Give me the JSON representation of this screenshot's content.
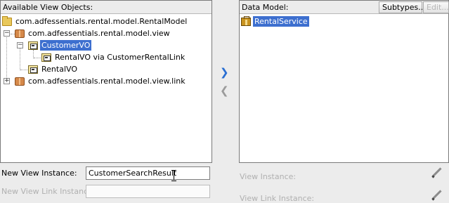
{
  "available": {
    "header": "Available View Objects:",
    "tree": [
      {
        "label": "com.adfessentials.rental.model.RentalModel",
        "icon": "folder-icon"
      },
      {
        "label": "com.adfessentials.rental.model.view",
        "icon": "package-icon",
        "expander": "−"
      },
      {
        "label": "CustomerVO",
        "icon": "view-object-icon",
        "expander": "−",
        "selected": true
      },
      {
        "label": "RentalVO via CustomerRentalLink",
        "icon": "view-object-icon"
      },
      {
        "label": "RentalVO",
        "icon": "view-object-icon"
      },
      {
        "label": "com.adfessentials.rental.model.view.link",
        "icon": "package-icon",
        "expander": "+"
      }
    ]
  },
  "data_model": {
    "header": "Data Model:",
    "subtypes_label": "Subtypes...",
    "edit_label": "Edit...",
    "tree": [
      {
        "label": "RentalService",
        "icon": "application-module-icon",
        "selected": true
      }
    ]
  },
  "shuttle": {
    "add_glyph": "❯",
    "remove_glyph": "❮"
  },
  "form": {
    "view_instance_label": "New View Instance:",
    "view_instance_value": "CustomerSearchResult",
    "view_link_instance_label": "New View Link Instance:",
    "view_link_instance_value": "",
    "right_view_instance_label": "View Instance:",
    "right_view_link_instance_label": "View Link Instance:"
  }
}
